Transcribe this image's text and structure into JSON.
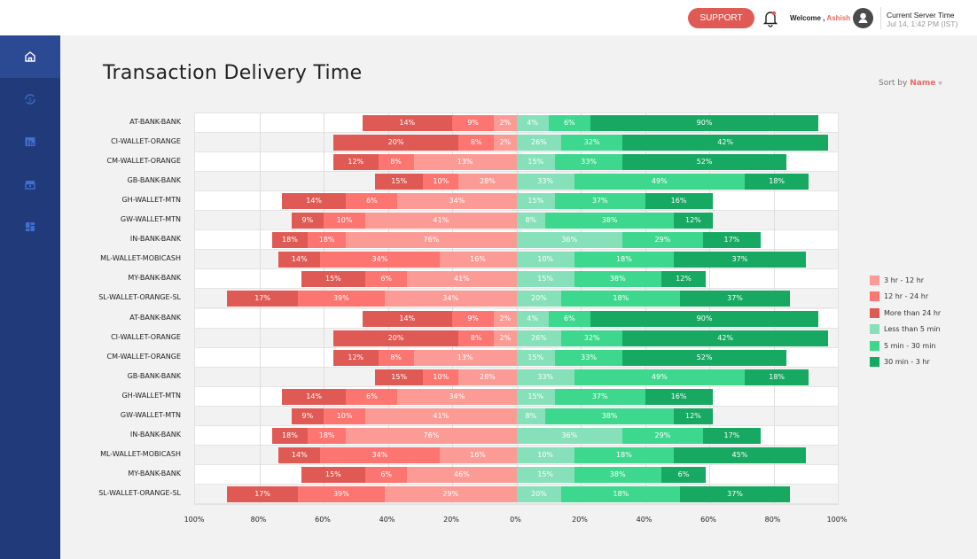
{
  "header": {
    "support_label": "SUPPORT",
    "welcome_prefix": "Welcome , ",
    "user_name": "Ashish",
    "server_time_label": "Current Server Time",
    "server_time": "Jul 14, 1:42 PM (IST)"
  },
  "sidebar": {
    "items": [
      {
        "icon": "home-icon",
        "active": true
      },
      {
        "icon": "currency-refresh-icon"
      },
      {
        "icon": "bar-chart-icon"
      },
      {
        "icon": "store-icon"
      },
      {
        "icon": "dashboard-icon"
      }
    ]
  },
  "page": {
    "title": "Transaction Delivery Time",
    "sort_prefix": "Sort by",
    "sort_value": "Name"
  },
  "colors": {
    "accent": "#e05a55",
    "sidebar": "#213a7a"
  },
  "chart_data": {
    "type": "bar",
    "orientation": "horizontal",
    "stacked": "diverging",
    "xlim": [
      -100,
      100
    ],
    "xticks": [
      "100%",
      "80%",
      "60%",
      "40%",
      "20%",
      "0%",
      "20%",
      "40%",
      "60%",
      "80%",
      "100%"
    ],
    "grid": true,
    "legend": "right",
    "series": [
      {
        "name": "3 hr - 12 hr",
        "color": "#fc9b95"
      },
      {
        "name": "12 hr - 24 hr",
        "color": "#fd7571"
      },
      {
        "name": "More than 24 hr",
        "color": "#e05a55"
      },
      {
        "name": "Less than 5 min",
        "color": "#86e0b9"
      },
      {
        "name": "5 min - 30 min",
        "color": "#3dd88d"
      },
      {
        "name": "30 min - 3 hr",
        "color": "#17a862"
      }
    ],
    "segment_series_order": [
      2,
      1,
      0,
      3,
      4,
      5
    ],
    "rows": [
      {
        "name": "AT-BANK-BANK",
        "labels": [
          "14%",
          "9%",
          "2%",
          "4%",
          "6%",
          "90%"
        ],
        "bounds": [
          -48,
          -20,
          -7,
          10,
          23,
          94
        ]
      },
      {
        "name": "CI-WALLET-ORANGE",
        "labels": [
          "20%",
          "8%",
          "2%",
          "26%",
          "32%",
          "42%"
        ],
        "bounds": [
          -57,
          -18,
          -7,
          14,
          33,
          97
        ]
      },
      {
        "name": "CM-WALLET-ORANGE",
        "labels": [
          "12%",
          "8%",
          "13%",
          "15%",
          "33%",
          "52%"
        ],
        "bounds": [
          -57,
          -43,
          -32,
          12,
          33,
          84
        ]
      },
      {
        "name": "GB-BANK-BANK",
        "labels": [
          "15%",
          "10%",
          "28%",
          "33%",
          "49%",
          "18%"
        ],
        "bounds": [
          -44,
          -29,
          -18,
          18,
          71,
          91
        ]
      },
      {
        "name": "GH-WALLET-MTN",
        "labels": [
          "14%",
          "6%",
          "34%",
          "15%",
          "37%",
          "16%"
        ],
        "bounds": [
          -73,
          -53,
          -37,
          12,
          40,
          61
        ]
      },
      {
        "name": "GW-WALLET-MTN",
        "labels": [
          "9%",
          "10%",
          "41%",
          "8%",
          "38%",
          "12%"
        ],
        "bounds": [
          -70,
          -60,
          -47,
          9,
          49,
          61
        ]
      },
      {
        "name": "IN-BANK-BANK",
        "labels": [
          "18%",
          "18%",
          "76%",
          "36%",
          "29%",
          "17%"
        ],
        "bounds": [
          -76,
          -65,
          -53,
          33,
          58,
          76
        ]
      },
      {
        "name": "ML-WALLET-MOBICASH",
        "labels": [
          "14%",
          "34%",
          "16%",
          "10%",
          "18%",
          "37%"
        ],
        "bounds": [
          -74,
          -61,
          -24,
          18,
          49,
          90
        ]
      },
      {
        "name": "MY-BANK-BANK",
        "labels": [
          "15%",
          "6%",
          "41%",
          "15%",
          "38%",
          "12%"
        ],
        "bounds": [
          -67,
          -47,
          -34,
          18,
          45,
          59
        ]
      },
      {
        "name": "SL-WALLET-ORANGE-SL",
        "labels": [
          "17%",
          "39%",
          "34%",
          "20%",
          "18%",
          "37%"
        ],
        "bounds": [
          -90,
          -68,
          -41,
          14,
          51,
          85
        ]
      },
      {
        "name": "AT-BANK-BANK",
        "labels": [
          "14%",
          "9%",
          "2%",
          "4%",
          "6%",
          "90%"
        ],
        "bounds": [
          -48,
          -20,
          -7,
          10,
          23,
          94
        ]
      },
      {
        "name": "CI-WALLET-ORANGE",
        "labels": [
          "20%",
          "8%",
          "2%",
          "26%",
          "32%",
          "42%"
        ],
        "bounds": [
          -57,
          -18,
          -7,
          14,
          33,
          97
        ]
      },
      {
        "name": "CM-WALLET-ORANGE",
        "labels": [
          "12%",
          "8%",
          "13%",
          "15%",
          "33%",
          "52%"
        ],
        "bounds": [
          -57,
          -43,
          -32,
          12,
          33,
          84
        ]
      },
      {
        "name": "GB-BANK-BANK",
        "labels": [
          "15%",
          "10%",
          "28%",
          "33%",
          "49%",
          "18%"
        ],
        "bounds": [
          -44,
          -29,
          -18,
          18,
          71,
          91
        ]
      },
      {
        "name": "GH-WALLET-MTN",
        "labels": [
          "14%",
          "6%",
          "34%",
          "15%",
          "37%",
          "16%"
        ],
        "bounds": [
          -73,
          -53,
          -37,
          12,
          40,
          61
        ]
      },
      {
        "name": "GW-WALLET-MTN",
        "labels": [
          "9%",
          "10%",
          "41%",
          "8%",
          "38%",
          "12%"
        ],
        "bounds": [
          -70,
          -60,
          -47,
          9,
          49,
          61
        ]
      },
      {
        "name": "IN-BANK-BANK",
        "labels": [
          "18%",
          "18%",
          "76%",
          "36%",
          "29%",
          "17%"
        ],
        "bounds": [
          -76,
          -65,
          -53,
          33,
          58,
          76
        ]
      },
      {
        "name": "ML-WALLET-MOBICASH",
        "labels": [
          "14%",
          "34%",
          "16%",
          "10%",
          "18%",
          "45%"
        ],
        "bounds": [
          -74,
          -61,
          -24,
          18,
          49,
          90
        ]
      },
      {
        "name": "MY-BANK-BANK",
        "labels": [
          "15%",
          "6%",
          "46%",
          "15%",
          "38%",
          "6%"
        ],
        "bounds": [
          -67,
          -47,
          -34,
          18,
          45,
          59
        ]
      },
      {
        "name": "SL-WALLET-ORANGE-SL",
        "labels": [
          "17%",
          "39%",
          "29%",
          "20%",
          "18%",
          "37%"
        ],
        "bounds": [
          -90,
          -68,
          -41,
          14,
          51,
          85
        ]
      }
    ]
  }
}
